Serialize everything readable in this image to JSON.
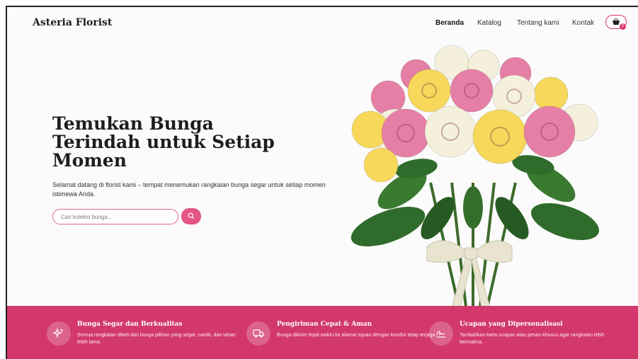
{
  "brand": "Asteria Florist",
  "nav": {
    "items": [
      {
        "label": "Beranda",
        "active": true
      },
      {
        "label": "Katalog",
        "active": false
      },
      {
        "label": "Tentang kami",
        "active": false
      },
      {
        "label": "Kontak",
        "active": false
      }
    ],
    "cart_icon": "basket-icon",
    "cart_count": "0"
  },
  "hero": {
    "title": "Temukan Bunga Terindah untuk Setiap Momen",
    "description": "Selamat datang di florist kami – tempat menemukan rangkaian bunga segar untuk setiap momen istimewa Anda.",
    "search_placeholder": "Cari koleksi bunga...",
    "search_icon": "search-icon"
  },
  "features": [
    {
      "icon": "sparkle-icon",
      "title": "Bunga Segar dan Berkualitas",
      "description": "Semua rangkaian dibeli dari bunga pilihan yang segar, cantik, dan tahan lebih lama."
    },
    {
      "icon": "truck-icon",
      "title": "Pengiriman Cepat & Aman",
      "description": "Bunga dikirim tepat waktu ke alamat tujuan dengan kondisi tetap terjaga."
    },
    {
      "icon": "signature-icon",
      "title": "Ucapan yang Dipersonalisasi",
      "description": "Tambahkan kartu ucapan atau pesan khusus agar rangkaian lebih bermakna."
    }
  ],
  "colors": {
    "accent": "#d2386c",
    "background": "#fbfbfb",
    "rose_pink": "#e67fa5",
    "rose_yellow": "#f7d85a",
    "rose_white": "#f5f0dc",
    "leaf": "#2f6b2a",
    "ribbon": "#e8e4cf"
  }
}
